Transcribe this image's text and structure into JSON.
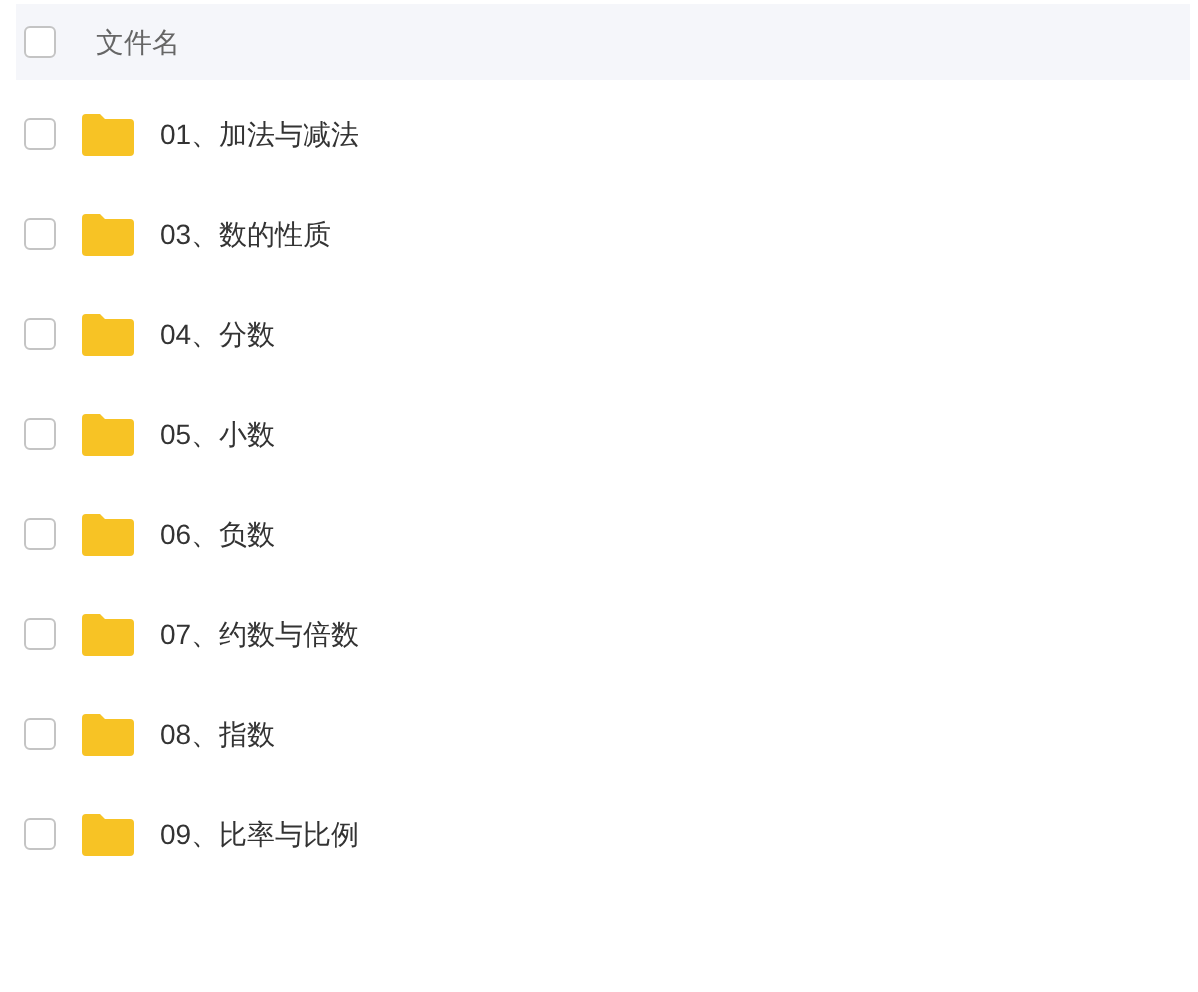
{
  "header": {
    "label": "文件名",
    "checked": false
  },
  "files": [
    {
      "name": "01、加法与减法",
      "checked": false
    },
    {
      "name": "03、数的性质",
      "checked": false
    },
    {
      "name": "04、分数",
      "checked": false
    },
    {
      "name": "05、小数",
      "checked": false
    },
    {
      "name": "06、负数",
      "checked": false
    },
    {
      "name": "07、约数与倍数",
      "checked": false
    },
    {
      "name": "08、指数",
      "checked": false
    },
    {
      "name": "09、比率与比例",
      "checked": false
    }
  ]
}
